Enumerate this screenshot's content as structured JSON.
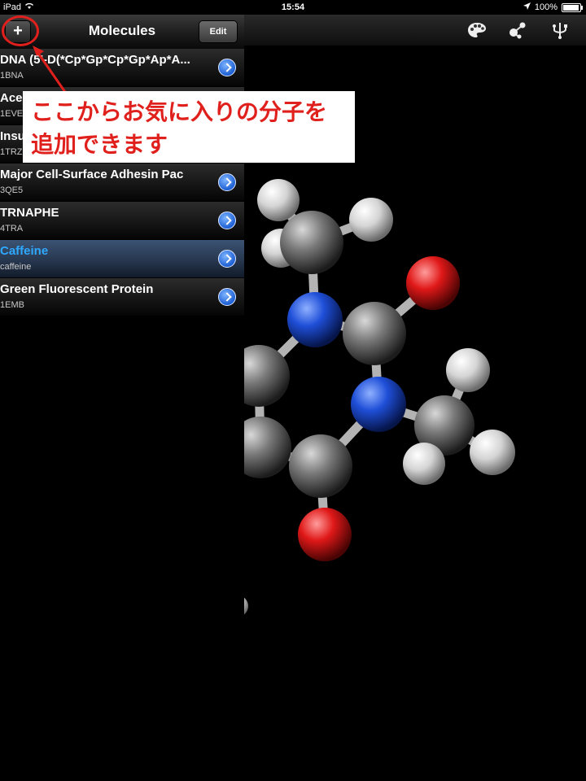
{
  "status_bar": {
    "device": "iPad",
    "time": "15:54",
    "battery": "100%"
  },
  "navbar": {
    "title": "Molecules",
    "add_label": "+",
    "edit_label": "Edit"
  },
  "molecules": [
    {
      "title": "DNA (5'-D(*Cp*Gp*Cp*Gp*Ap*A...",
      "id": "1BNA"
    },
    {
      "title": "Ace",
      "id": "1EVE"
    },
    {
      "title": "Insu",
      "id": "1TRZ"
    },
    {
      "title": "Major Cell-Surface Adhesin Pac",
      "id": "3QE5"
    },
    {
      "title": "TRNAPHE",
      "id": "4TRA"
    },
    {
      "title": "Caffeine",
      "id": "caffeine"
    },
    {
      "title": "Green Fluorescent Protein",
      "id": "1EMB"
    }
  ],
  "annotation": {
    "line1": "ここからお気に入りの分子を",
    "line2": "追加できます"
  },
  "toolbar_icons": [
    "palette-icon",
    "molecule-icon",
    "usb-icon"
  ],
  "colors": {
    "selected_text": "#2fa8ff",
    "annotation_red": "#e0201c",
    "carbon": "#7a7a7a",
    "nitrogen": "#1f4fd8",
    "oxygen": "#e01818",
    "hydrogen": "#e8e8e8"
  }
}
